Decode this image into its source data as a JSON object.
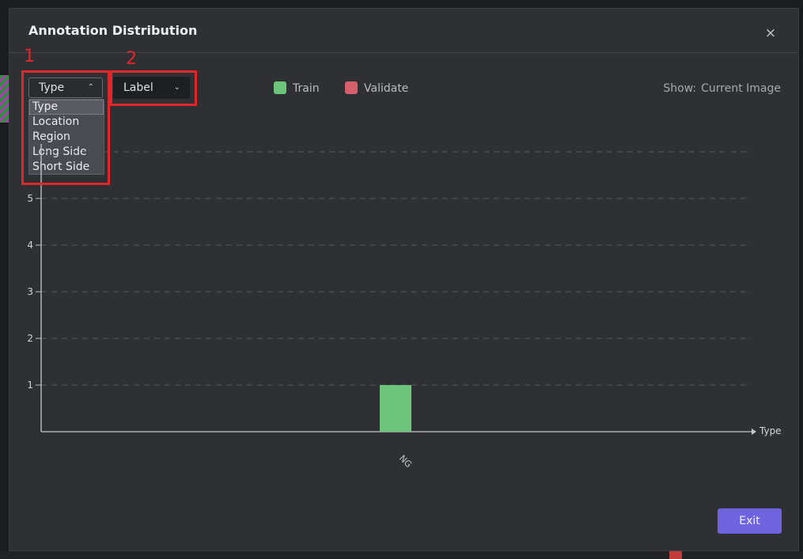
{
  "dialog": {
    "title": "Annotation Distribution",
    "close_symbol": "×",
    "exit_label": "Exit"
  },
  "controls": {
    "type_select": {
      "value": "Type",
      "options": [
        "Type",
        "Location",
        "Region",
        "Long Side",
        "Short Side"
      ],
      "selected_index": 0
    },
    "label_select": {
      "value": "Label"
    },
    "show_label": "Show:",
    "show_value": "Current Image"
  },
  "annotations": [
    {
      "number": "1",
      "color": "#e0262b"
    },
    {
      "number": "2",
      "color": "#e0262b"
    }
  ],
  "legend": [
    {
      "name": "Train",
      "color": "#6cc57a"
    },
    {
      "name": "Validate",
      "color": "#d65f6e"
    }
  ],
  "chart_data": {
    "type": "bar",
    "categories": [
      "NG"
    ],
    "series": [
      {
        "name": "Train",
        "values": [
          1
        ],
        "color": "#6cc57a"
      },
      {
        "name": "Validate",
        "values": [
          0
        ],
        "color": "#d65f6e"
      }
    ],
    "xlabel": "Type",
    "ylabel": "",
    "ylim": [
      0,
      6
    ],
    "yticks_visible": [
      1,
      2,
      3,
      4,
      5
    ],
    "grid": true
  }
}
